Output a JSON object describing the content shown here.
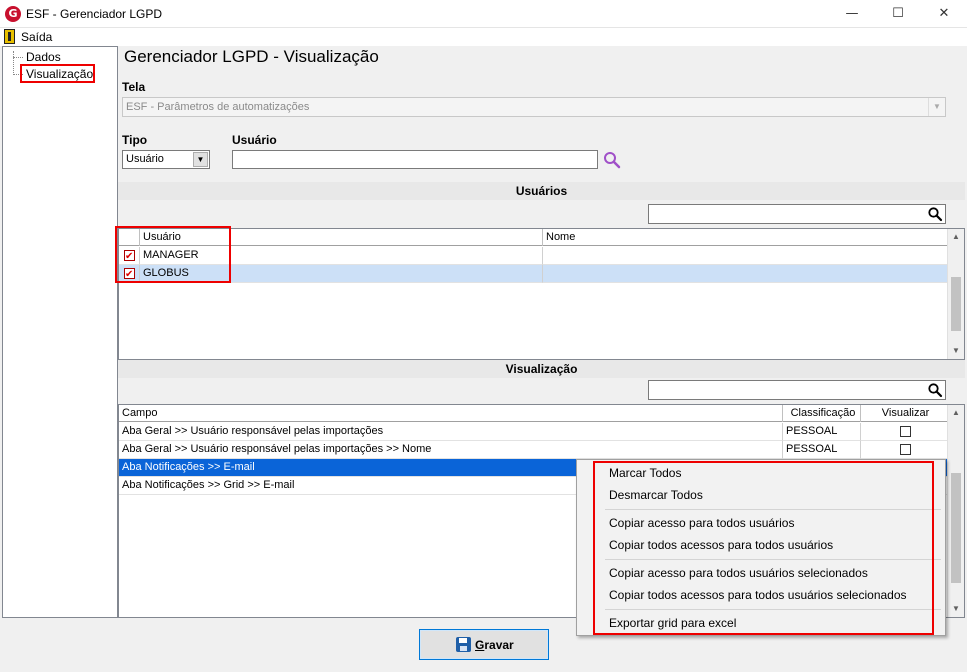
{
  "window": {
    "app_icon": "G",
    "title": "ESF - Gerenciador LGPD",
    "minimize_glyph": "—",
    "maximize_glyph": "☐",
    "close_glyph": "✕"
  },
  "menu": {
    "exit_label": "Saída"
  },
  "tree": {
    "items": [
      {
        "label": "Dados"
      },
      {
        "label": "Visualização"
      }
    ]
  },
  "main": {
    "title": "Gerenciador LGPD - Visualização",
    "tela": {
      "label": "Tela",
      "value": "ESF - Parâmetros de automatizações"
    },
    "tipo": {
      "label": "Tipo",
      "value": "Usuário"
    },
    "usuario": {
      "label": "Usuário",
      "value": ""
    }
  },
  "users_section": {
    "header": "Usuários",
    "search_value": "",
    "columns": [
      "Usuário",
      "Nome"
    ],
    "rows": [
      {
        "checked": true,
        "usuario": "MANAGER",
        "nome": ""
      },
      {
        "checked": true,
        "usuario": "GLOBUS",
        "nome": ""
      }
    ]
  },
  "view_section": {
    "header": "Visualização",
    "search_value": "",
    "columns": [
      "Campo",
      "Classificação",
      "Visualizar"
    ],
    "rows": [
      {
        "campo": "Aba Geral >> Usuário responsável pelas importações",
        "classificacao": "PESSOAL",
        "visualizar": false
      },
      {
        "campo": "Aba Geral >> Usuário responsável pelas importações >> Nome",
        "classificacao": "PESSOAL",
        "visualizar": false
      },
      {
        "campo": "Aba Notificações >> E-mail",
        "classificacao": "",
        "visualizar": false
      },
      {
        "campo": "Aba Notificações >> Grid >> E-mail",
        "classificacao": "",
        "visualizar": false
      }
    ]
  },
  "context_menu": {
    "items": [
      "Marcar Todos",
      "Desmarcar Todos",
      "Copiar acesso para todos usuários",
      "Copiar todos acessos para todos usuários",
      "Copiar acesso para todos usuários selecionados",
      "Copiar todos acessos para todos usuários selecionados",
      "Exportar grid para excel"
    ]
  },
  "footer": {
    "save_prefix": "G",
    "save_rest": "ravar"
  },
  "colors": {
    "highlight_border": "#ee0000",
    "selected_row": "#0a64d8",
    "selected_row_light": "#cce0f7",
    "brand": "#c8102e"
  },
  "icons": [
    "app-logo-icon",
    "exit-door-icon",
    "search-icon",
    "save-disk-icon"
  ]
}
